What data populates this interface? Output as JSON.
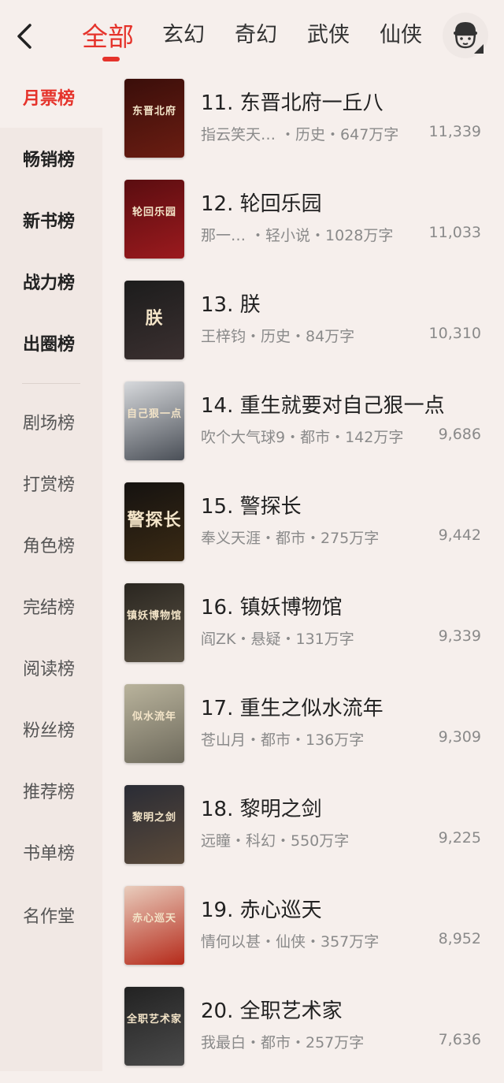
{
  "header": {
    "tabs": [
      {
        "label": "全部",
        "active": true
      },
      {
        "label": "玄幻",
        "active": false
      },
      {
        "label": "奇幻",
        "active": false
      },
      {
        "label": "武侠",
        "active": false
      },
      {
        "label": "仙侠",
        "active": false
      }
    ],
    "back_icon": "chevron-left-icon",
    "profile_icon": "avatar-face-icon",
    "accent_color": "#e5332b"
  },
  "sidebar": {
    "items": [
      {
        "label": "月票榜",
        "selected": true
      },
      {
        "label": "畅销榜"
      },
      {
        "label": "新书榜"
      },
      {
        "label": "战力榜"
      },
      {
        "label": "出圈榜"
      },
      {
        "label": "剧场榜"
      },
      {
        "label": "打赏榜"
      },
      {
        "label": "角色榜"
      },
      {
        "label": "完结榜"
      },
      {
        "label": "阅读榜"
      },
      {
        "label": "粉丝榜"
      },
      {
        "label": "推荐榜"
      },
      {
        "label": "书单榜"
      },
      {
        "label": "名作堂"
      }
    ]
  },
  "books": [
    {
      "title": "11. 东晋北府一丘八",
      "meta": "指云笑天… ・历史・647万字",
      "count": "11,339",
      "cover_text": "东晋北府",
      "cover_colors": [
        "#3a0e0a",
        "#6b1d12"
      ]
    },
    {
      "title": "12. 轮回乐园",
      "meta": "那一…   ・轻小说・1028万字",
      "count": "11,033",
      "cover_text": "轮回乐园",
      "cover_colors": [
        "#5a0d10",
        "#9b1a1e"
      ]
    },
    {
      "title": "13. 朕",
      "meta": "王梓钧・历史・84万字",
      "count": "10,310",
      "cover_text": "朕",
      "cover_colors": [
        "#1c1c1c",
        "#3b3030"
      ]
    },
    {
      "title": "14. 重生就要对自己狠一点",
      "meta": "吹个大气球9・都市・142万字",
      "count": "9,686",
      "cover_text": "自己狠一点",
      "cover_colors": [
        "#d7d9dc",
        "#4a4f57"
      ]
    },
    {
      "title": "15. 警探长",
      "meta": "奉义天涯・都市・275万字",
      "count": "9,442",
      "cover_text": "警探长",
      "cover_colors": [
        "#151210",
        "#3a2a14"
      ]
    },
    {
      "title": "16. 镇妖博物馆",
      "meta": "阎ZK・悬疑・131万字",
      "count": "9,339",
      "cover_text": "镇妖博物馆",
      "cover_colors": [
        "#2a2620",
        "#5c5446"
      ]
    },
    {
      "title": "17. 重生之似水流年",
      "meta": "苍山月・都市・136万字",
      "count": "9,309",
      "cover_text": "似水流年",
      "cover_colors": [
        "#b9b39c",
        "#6e6a5c"
      ]
    },
    {
      "title": "18. 黎明之剑",
      "meta": "远瞳・科幻・550万字",
      "count": "9,225",
      "cover_text": "黎明之剑",
      "cover_colors": [
        "#2a2c35",
        "#5b4a3a"
      ]
    },
    {
      "title": "19. 赤心巡天",
      "meta": "情何以甚・仙侠・357万字",
      "count": "8,952",
      "cover_text": "赤心巡天",
      "cover_colors": [
        "#e9cdbd",
        "#b52a1a"
      ]
    },
    {
      "title": "20. 全职艺术家",
      "meta": "我最白・都市・257万字",
      "count": "7,636",
      "cover_text": "全职艺术家",
      "cover_colors": [
        "#222222",
        "#4b4b4b"
      ]
    }
  ]
}
